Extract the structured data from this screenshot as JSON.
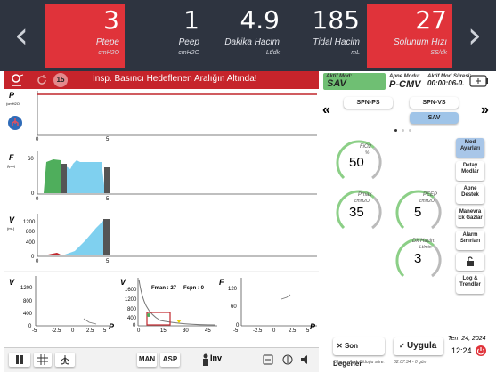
{
  "params": [
    {
      "value": "3",
      "label": "Ptepe",
      "unit": "cmH2O",
      "alarm": true
    },
    {
      "value": "1",
      "label": "Peep",
      "unit": "cmH2O",
      "alarm": false
    },
    {
      "value": "4.9",
      "label": "Dakika Hacim",
      "unit": "Lt/dk",
      "alarm": false
    },
    {
      "value": "185",
      "label": "Tidal Hacim",
      "unit": "mL",
      "alarm": false
    },
    {
      "value": "27",
      "label": "Solunum Hızı",
      "unit": "SS/dk",
      "alarm": true
    }
  ],
  "alarm": {
    "message": "İnsp. Basıncı Hedeflenen Aralığın Altında!",
    "count": "15"
  },
  "graphs": {
    "p_label": "P",
    "p_unit": "(cmH2O)",
    "f_label": "F",
    "f_unit": "(lpm)",
    "f_ticks": [
      "60",
      "0"
    ],
    "v_label": "V",
    "v_unit": "(mL)",
    "v_ticks": [
      "1200",
      "800",
      "400",
      "0"
    ],
    "x_ticks": [
      "0",
      "5"
    ],
    "loop_v_label": "V",
    "loop_v_ticks": [
      "1200",
      "800",
      "400",
      "0"
    ],
    "loop_x_ticks": [
      "-5",
      "-2.5",
      "0",
      "2.5",
      "5"
    ],
    "loop_p_label": "P",
    "mid_v_label": "V",
    "mid_ticks": [
      "1600",
      "1200",
      "800",
      "400",
      "0"
    ],
    "mid_x_ticks": [
      "0",
      "15",
      "30",
      "45"
    ],
    "fman": "Fman : 27",
    "fspn": "Fspn : 0",
    "right_f_label": "F",
    "right_ticks": [
      "120",
      "60",
      "0"
    ],
    "right_x_ticks": [
      "-5",
      "-2.5",
      "0",
      "2.5",
      "5"
    ],
    "right_p_label": "P",
    "colors": {
      "flow_green": "#4fae5c",
      "flow_blue": "#7fd0ef",
      "dark": "#555555",
      "red": "#c0262c"
    }
  },
  "mode": {
    "active_label": "Aktif Mod:",
    "active_value": "SAV",
    "apne_label": "Apne Modu:",
    "apne_value": "P-CMV",
    "duration_label": "Aktif Mod Süresi:",
    "duration_value": "00:00:06-0."
  },
  "mode_buttons": [
    "SPN-PS",
    "SPN-VS",
    "SAV"
  ],
  "dials": [
    {
      "label": "FiO2",
      "unit": "%",
      "value": "50"
    },
    {
      "label": "Pmax",
      "unit": "cmH2O",
      "value": "35"
    },
    {
      "label": "PEEP",
      "unit": "cmH2O",
      "value": "5"
    },
    {
      "label": "Dk Hacim",
      "unit": "Lt/min",
      "value": "3"
    }
  ],
  "side_buttons": [
    {
      "label": "Mod Ayarları",
      "active": true
    },
    {
      "label": "Detay Modlar",
      "active": false
    },
    {
      "label": "Apne Destek",
      "active": false
    },
    {
      "label": "Manevra Ek Gazlar",
      "active": false
    },
    {
      "label": "Alarm Sınırları",
      "active": false
    },
    {
      "label": "lock-icon",
      "active": false
    },
    {
      "label": "Log & Trendler",
      "active": false
    }
  ],
  "bottom": {
    "man": "MAN",
    "asp": "ASP",
    "inv": "Inv"
  },
  "actions": {
    "son_degerler": "Son Değerler",
    "uygula": "Uygula"
  },
  "footer": {
    "cihaz": "Cihazın Açık Olduğu süre:",
    "uptime": "02:07:34 - 0 gün",
    "date": "Tem 24, 2024",
    "time": "12:24"
  }
}
